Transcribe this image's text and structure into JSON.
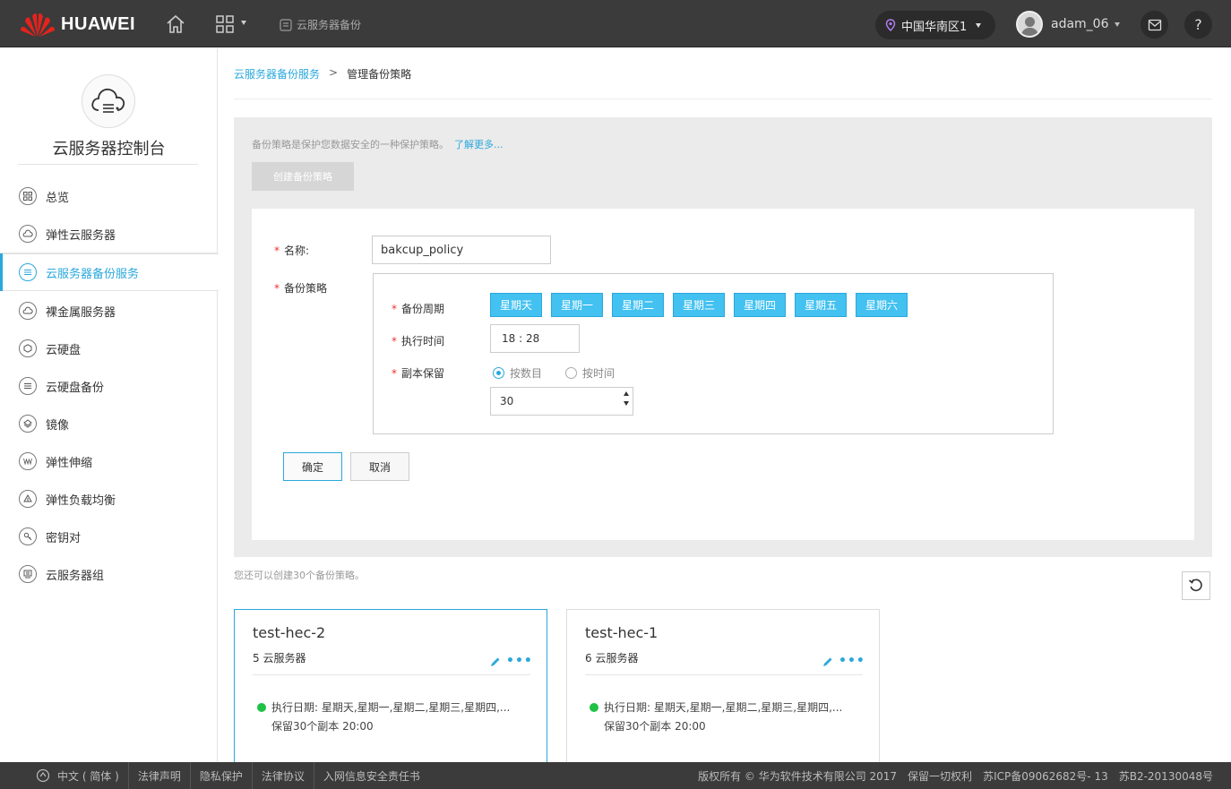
{
  "header": {
    "brand": "HUAWEI",
    "service_label": "云服务器备份",
    "region": "中国华南区1",
    "username": "adam_06",
    "help_label": "?"
  },
  "sidebar": {
    "title": "云服务器控制台",
    "items": [
      {
        "label": "总览",
        "icon": "overview-icon"
      },
      {
        "label": "弹性云服务器",
        "icon": "ecs-icon"
      },
      {
        "label": "云服务器备份服务",
        "icon": "backup-icon"
      },
      {
        "label": "裸金属服务器",
        "icon": "bare-metal-icon"
      },
      {
        "label": "云硬盘",
        "icon": "disk-icon"
      },
      {
        "label": "云硬盘备份",
        "icon": "disk-backup-icon"
      },
      {
        "label": "镜像",
        "icon": "image-icon"
      },
      {
        "label": "弹性伸缩",
        "icon": "autoscaling-icon"
      },
      {
        "label": "弹性负载均衡",
        "icon": "load-balancer-icon"
      },
      {
        "label": "密钥对",
        "icon": "key-pair-icon"
      },
      {
        "label": "云服务器组",
        "icon": "server-group-icon"
      }
    ],
    "active_index": 2
  },
  "breadcrumb": {
    "parent": "云服务器备份服务",
    "separator": ">",
    "current": "管理备份策略"
  },
  "intro": {
    "text": "备份策略是保护您数据安全的一种保护策略。",
    "more_link": "了解更多..."
  },
  "create_button": "创建备份策略",
  "form": {
    "name_label": "名称:",
    "name_value": "bakcup_policy",
    "policy_label": "备份策略",
    "cycle_label": "备份周期",
    "days": [
      "星期天",
      "星期一",
      "星期二",
      "星期三",
      "星期四",
      "星期五",
      "星期六"
    ],
    "time_label": "执行时间",
    "time_value": "18 : 28",
    "keep_label": "副本保留",
    "keep_options": [
      "按数目",
      "按时间"
    ],
    "keep_selected": "按数目",
    "keep_count": "30",
    "ok": "确定",
    "cancel": "取消"
  },
  "remaining_text": "您还可以创建30个备份策略。",
  "policies": [
    {
      "name": "test-hec-2",
      "servers": "5 云服务器",
      "schedule": "执行日期: 星期天,星期一,星期二,星期三,星期四,...",
      "retention": "保留30个副本 20:00"
    },
    {
      "name": "test-hec-1",
      "servers": "6 云服务器",
      "schedule": "执行日期: 星期天,星期一,星期二,星期三,星期四,...",
      "retention": "保留30个副本 20:00"
    }
  ],
  "footer": {
    "language": "中文 ( 简体 )",
    "links": [
      "法律声明",
      "隐私保护",
      "法律协议",
      "入网信息安全责任书"
    ],
    "copyright": "版权所有 © 华为软件技术有限公司 2017",
    "rights": "保留一切权利",
    "icp": "苏ICP备09062682号- 13",
    "license": "苏B2-20130048号"
  },
  "colors": {
    "accent": "#2aa8dc",
    "day_button": "#43c1f0",
    "topbar": "#3b3b3b",
    "status_green": "#1fc244",
    "required": "#ee3333"
  }
}
